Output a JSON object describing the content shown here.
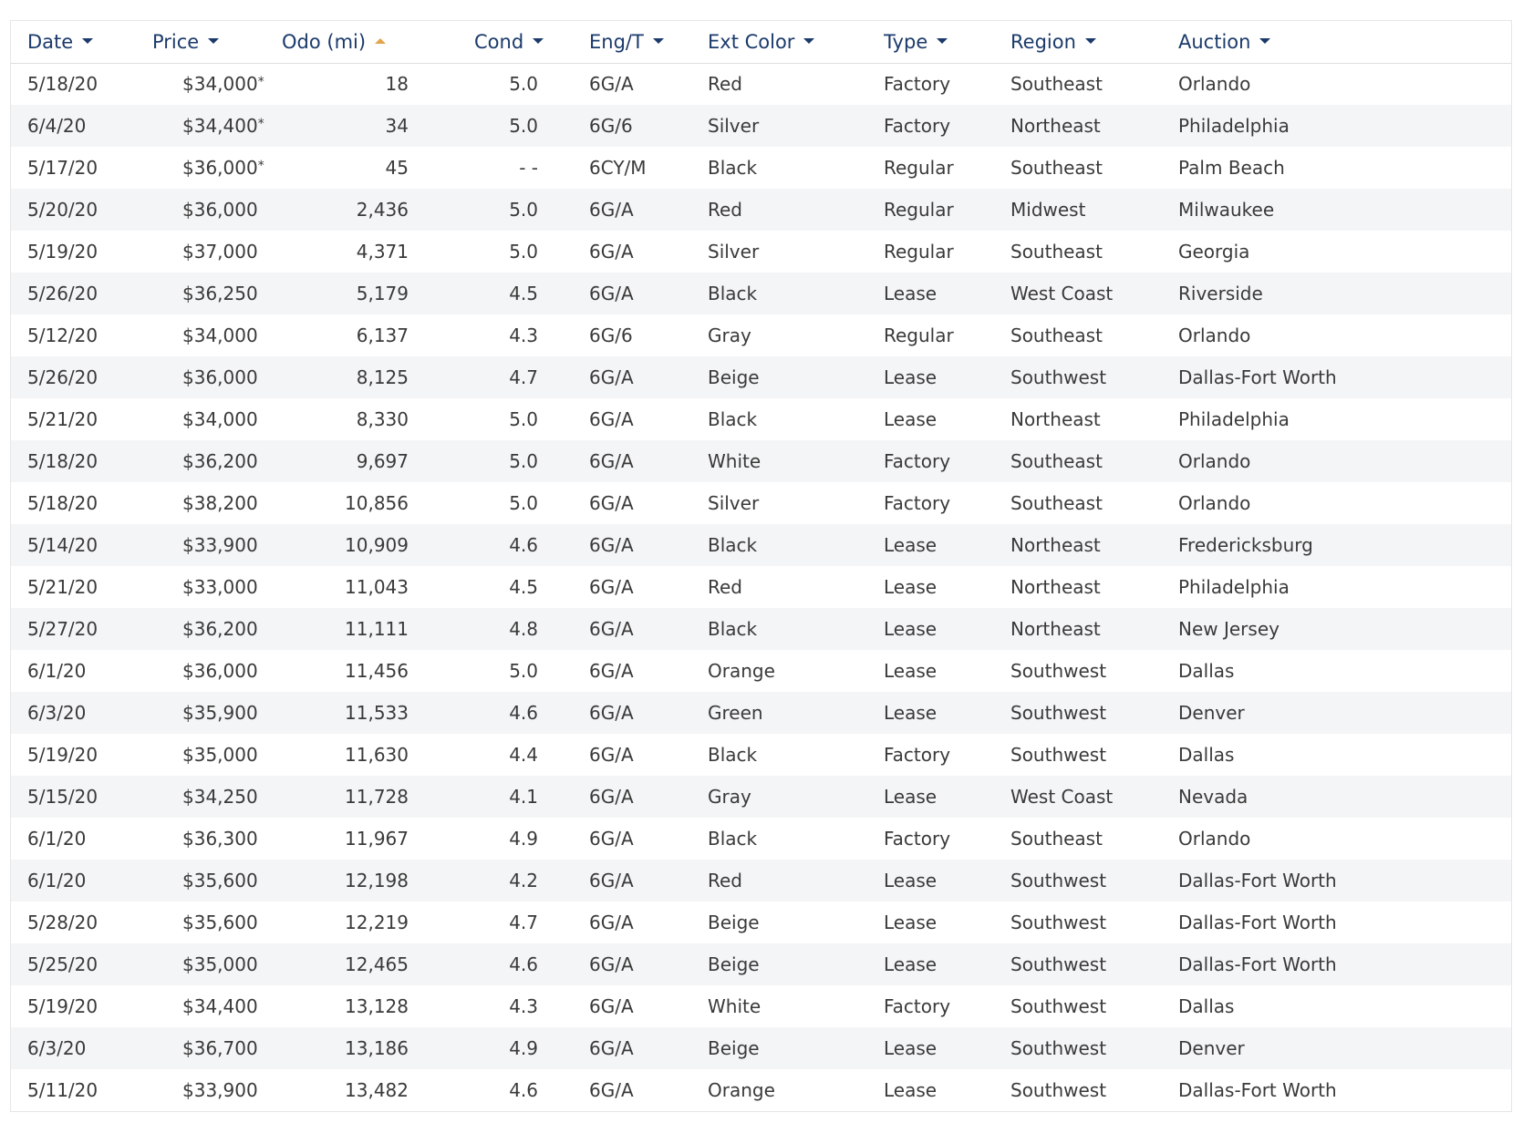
{
  "columns": [
    {
      "key": "date",
      "label": "Date",
      "sort": "down"
    },
    {
      "key": "price",
      "label": "Price",
      "sort": "down"
    },
    {
      "key": "odo",
      "label": "Odo (mi)",
      "sort": "up"
    },
    {
      "key": "cond",
      "label": "Cond",
      "sort": "down"
    },
    {
      "key": "eng",
      "label": "Eng/T",
      "sort": "down"
    },
    {
      "key": "color",
      "label": "Ext Color",
      "sort": "down"
    },
    {
      "key": "type",
      "label": "Type",
      "sort": "down"
    },
    {
      "key": "region",
      "label": "Region",
      "sort": "down"
    },
    {
      "key": "auction",
      "label": "Auction",
      "sort": "down"
    }
  ],
  "colors": {
    "header_text": "#1b3a6b",
    "active_sort_arrow": "#e3a44c",
    "stripe": "#f4f5f6"
  },
  "rows": [
    {
      "date": "5/18/20",
      "price": "$34,000",
      "price_mark": "*",
      "odo": "18",
      "cond": "5.0",
      "eng": "6G/A",
      "color": "Red",
      "type": "Factory",
      "region": "Southeast",
      "auction": "Orlando"
    },
    {
      "date": "6/4/20",
      "price": "$34,400",
      "price_mark": "*",
      "odo": "34",
      "cond": "5.0",
      "eng": "6G/6",
      "color": "Silver",
      "type": "Factory",
      "region": "Northeast",
      "auction": "Philadelphia"
    },
    {
      "date": "5/17/20",
      "price": "$36,000",
      "price_mark": "*",
      "odo": "45",
      "cond": "- -",
      "eng": "6CY/M",
      "color": "Black",
      "type": "Regular",
      "region": "Southeast",
      "auction": "Palm Beach"
    },
    {
      "date": "5/20/20",
      "price": "$36,000",
      "price_mark": "",
      "odo": "2,436",
      "cond": "5.0",
      "eng": "6G/A",
      "color": "Red",
      "type": "Regular",
      "region": "Midwest",
      "auction": "Milwaukee"
    },
    {
      "date": "5/19/20",
      "price": "$37,000",
      "price_mark": "",
      "odo": "4,371",
      "cond": "5.0",
      "eng": "6G/A",
      "color": "Silver",
      "type": "Regular",
      "region": "Southeast",
      "auction": "Georgia"
    },
    {
      "date": "5/26/20",
      "price": "$36,250",
      "price_mark": "",
      "odo": "5,179",
      "cond": "4.5",
      "eng": "6G/A",
      "color": "Black",
      "type": "Lease",
      "region": "West Coast",
      "auction": "Riverside"
    },
    {
      "date": "5/12/20",
      "price": "$34,000",
      "price_mark": "",
      "odo": "6,137",
      "cond": "4.3",
      "eng": "6G/6",
      "color": "Gray",
      "type": "Regular",
      "region": "Southeast",
      "auction": "Orlando"
    },
    {
      "date": "5/26/20",
      "price": "$36,000",
      "price_mark": "",
      "odo": "8,125",
      "cond": "4.7",
      "eng": "6G/A",
      "color": "Beige",
      "type": "Lease",
      "region": "Southwest",
      "auction": "Dallas-Fort Worth"
    },
    {
      "date": "5/21/20",
      "price": "$34,000",
      "price_mark": "",
      "odo": "8,330",
      "cond": "5.0",
      "eng": "6G/A",
      "color": "Black",
      "type": "Lease",
      "region": "Northeast",
      "auction": "Philadelphia"
    },
    {
      "date": "5/18/20",
      "price": "$36,200",
      "price_mark": "",
      "odo": "9,697",
      "cond": "5.0",
      "eng": "6G/A",
      "color": "White",
      "type": "Factory",
      "region": "Southeast",
      "auction": "Orlando"
    },
    {
      "date": "5/18/20",
      "price": "$38,200",
      "price_mark": "",
      "odo": "10,856",
      "cond": "5.0",
      "eng": "6G/A",
      "color": "Silver",
      "type": "Factory",
      "region": "Southeast",
      "auction": "Orlando"
    },
    {
      "date": "5/14/20",
      "price": "$33,900",
      "price_mark": "",
      "odo": "10,909",
      "cond": "4.6",
      "eng": "6G/A",
      "color": "Black",
      "type": "Lease",
      "region": "Northeast",
      "auction": "Fredericksburg"
    },
    {
      "date": "5/21/20",
      "price": "$33,000",
      "price_mark": "",
      "odo": "11,043",
      "cond": "4.5",
      "eng": "6G/A",
      "color": "Red",
      "type": "Lease",
      "region": "Northeast",
      "auction": "Philadelphia"
    },
    {
      "date": "5/27/20",
      "price": "$36,200",
      "price_mark": "",
      "odo": "11,111",
      "cond": "4.8",
      "eng": "6G/A",
      "color": "Black",
      "type": "Lease",
      "region": "Northeast",
      "auction": "New Jersey"
    },
    {
      "date": "6/1/20",
      "price": "$36,000",
      "price_mark": "",
      "odo": "11,456",
      "cond": "5.0",
      "eng": "6G/A",
      "color": "Orange",
      "type": "Lease",
      "region": "Southwest",
      "auction": "Dallas"
    },
    {
      "date": "6/3/20",
      "price": "$35,900",
      "price_mark": "",
      "odo": "11,533",
      "cond": "4.6",
      "eng": "6G/A",
      "color": "Green",
      "type": "Lease",
      "region": "Southwest",
      "auction": "Denver"
    },
    {
      "date": "5/19/20",
      "price": "$35,000",
      "price_mark": "",
      "odo": "11,630",
      "cond": "4.4",
      "eng": "6G/A",
      "color": "Black",
      "type": "Factory",
      "region": "Southwest",
      "auction": "Dallas"
    },
    {
      "date": "5/15/20",
      "price": "$34,250",
      "price_mark": "",
      "odo": "11,728",
      "cond": "4.1",
      "eng": "6G/A",
      "color": "Gray",
      "type": "Lease",
      "region": "West Coast",
      "auction": "Nevada"
    },
    {
      "date": "6/1/20",
      "price": "$36,300",
      "price_mark": "",
      "odo": "11,967",
      "cond": "4.9",
      "eng": "6G/A",
      "color": "Black",
      "type": "Factory",
      "region": "Southeast",
      "auction": "Orlando"
    },
    {
      "date": "6/1/20",
      "price": "$35,600",
      "price_mark": "",
      "odo": "12,198",
      "cond": "4.2",
      "eng": "6G/A",
      "color": "Red",
      "type": "Lease",
      "region": "Southwest",
      "auction": "Dallas-Fort Worth"
    },
    {
      "date": "5/28/20",
      "price": "$35,600",
      "price_mark": "",
      "odo": "12,219",
      "cond": "4.7",
      "eng": "6G/A",
      "color": "Beige",
      "type": "Lease",
      "region": "Southwest",
      "auction": "Dallas-Fort Worth"
    },
    {
      "date": "5/25/20",
      "price": "$35,000",
      "price_mark": "",
      "odo": "12,465",
      "cond": "4.6",
      "eng": "6G/A",
      "color": "Beige",
      "type": "Lease",
      "region": "Southwest",
      "auction": "Dallas-Fort Worth"
    },
    {
      "date": "5/19/20",
      "price": "$34,400",
      "price_mark": "",
      "odo": "13,128",
      "cond": "4.3",
      "eng": "6G/A",
      "color": "White",
      "type": "Factory",
      "region": "Southwest",
      "auction": "Dallas"
    },
    {
      "date": "6/3/20",
      "price": "$36,700",
      "price_mark": "",
      "odo": "13,186",
      "cond": "4.9",
      "eng": "6G/A",
      "color": "Beige",
      "type": "Lease",
      "region": "Southwest",
      "auction": "Denver"
    },
    {
      "date": "5/11/20",
      "price": "$33,900",
      "price_mark": "",
      "odo": "13,482",
      "cond": "4.6",
      "eng": "6G/A",
      "color": "Orange",
      "type": "Lease",
      "region": "Southwest",
      "auction": "Dallas-Fort Worth"
    }
  ]
}
